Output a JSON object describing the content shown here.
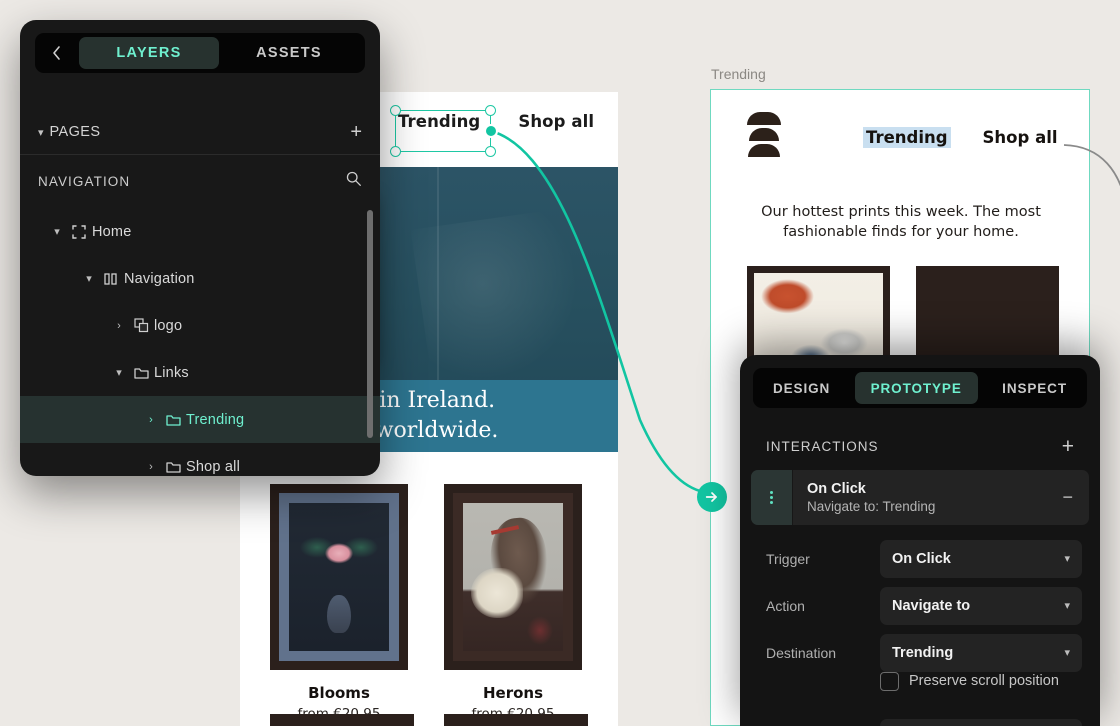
{
  "layers_panel": {
    "back_icon": "chevron-left-icon",
    "tabs": [
      {
        "label": "LAYERS",
        "active": true
      },
      {
        "label": "ASSETS",
        "active": false
      }
    ],
    "pages": {
      "label": "PAGES",
      "add_icon": "plus-icon",
      "chevron": "chevron-down-icon"
    },
    "navigation_header": {
      "label": "NAVIGATION",
      "search_icon": "search-icon"
    },
    "tree": [
      {
        "name": "Home",
        "icon": "frame-icon",
        "depth": 0,
        "twisty": "chevron-down-icon",
        "selected": false
      },
      {
        "name": "Navigation",
        "icon": "component-icon",
        "depth": 1,
        "twisty": "chevron-down-icon",
        "selected": false
      },
      {
        "name": "logo",
        "icon": "image-icon",
        "depth": 2,
        "twisty": "chevron-right-icon",
        "selected": false
      },
      {
        "name": "Links",
        "icon": "folder-icon",
        "depth": 2,
        "twisty": "chevron-down-icon",
        "selected": false
      },
      {
        "name": "Trending",
        "icon": "folder-icon",
        "depth": 3,
        "twisty": "chevron-right-icon",
        "selected": true
      },
      {
        "name": "Shop all",
        "icon": "folder-icon",
        "depth": 3,
        "twisty": "chevron-right-icon",
        "selected": false
      }
    ]
  },
  "prototype_panel": {
    "tabs": [
      {
        "label": "DESIGN",
        "active": false
      },
      {
        "label": "PROTOTYPE",
        "active": true
      },
      {
        "label": "INSPECT",
        "active": false
      }
    ],
    "interactions": {
      "label": "INTERACTIONS",
      "add_icon": "plus-icon"
    },
    "interaction_card": {
      "title": "On Click",
      "subtitle": "Navigate to: Trending",
      "grip_icon": "drag-handle-icon",
      "remove_icon": "minus-icon"
    },
    "fields": [
      {
        "label": "Trigger",
        "value": "On Click",
        "chevron": "chevron-down-icon"
      },
      {
        "label": "Action",
        "value": "Navigate to",
        "chevron": "chevron-down-icon"
      },
      {
        "label": "Destination",
        "value": "Trending",
        "chevron": "chevron-down-icon"
      }
    ],
    "checkbox": {
      "label": "Preserve scroll position",
      "checked": false
    }
  },
  "canvas": {
    "background_color": "#ece9e5",
    "accent_color": "#12c5a2",
    "home_frame": {
      "nav_links": [
        "Trending",
        "Shop all"
      ],
      "hero_line_1": "Designed in Ireland.",
      "hero_line_2": "Shipping worldwide.",
      "hero_bg_color": "#2d7590",
      "products": [
        {
          "title": "Blooms",
          "price": "from €20.95"
        },
        {
          "title": "Herons",
          "price": "from €20.95"
        }
      ]
    },
    "trending_frame": {
      "label": "Trending",
      "logo_icon": "stacked-arches-logo-icon",
      "nav_links": [
        "Trending",
        "Shop all"
      ],
      "highlighted_link": "Trending",
      "highlight_color": "#c9dff0",
      "subtitle": "Our hottest prints this week. The most fashionable finds for your home.",
      "border_color": "#6fd9c0",
      "artworks": [
        "wave-print",
        "cityscape-print"
      ]
    },
    "connector": {
      "source": "Trending",
      "target": "Trending frame",
      "arrow_icon": "arrow-right-icon",
      "color": "#12c5a2"
    }
  }
}
